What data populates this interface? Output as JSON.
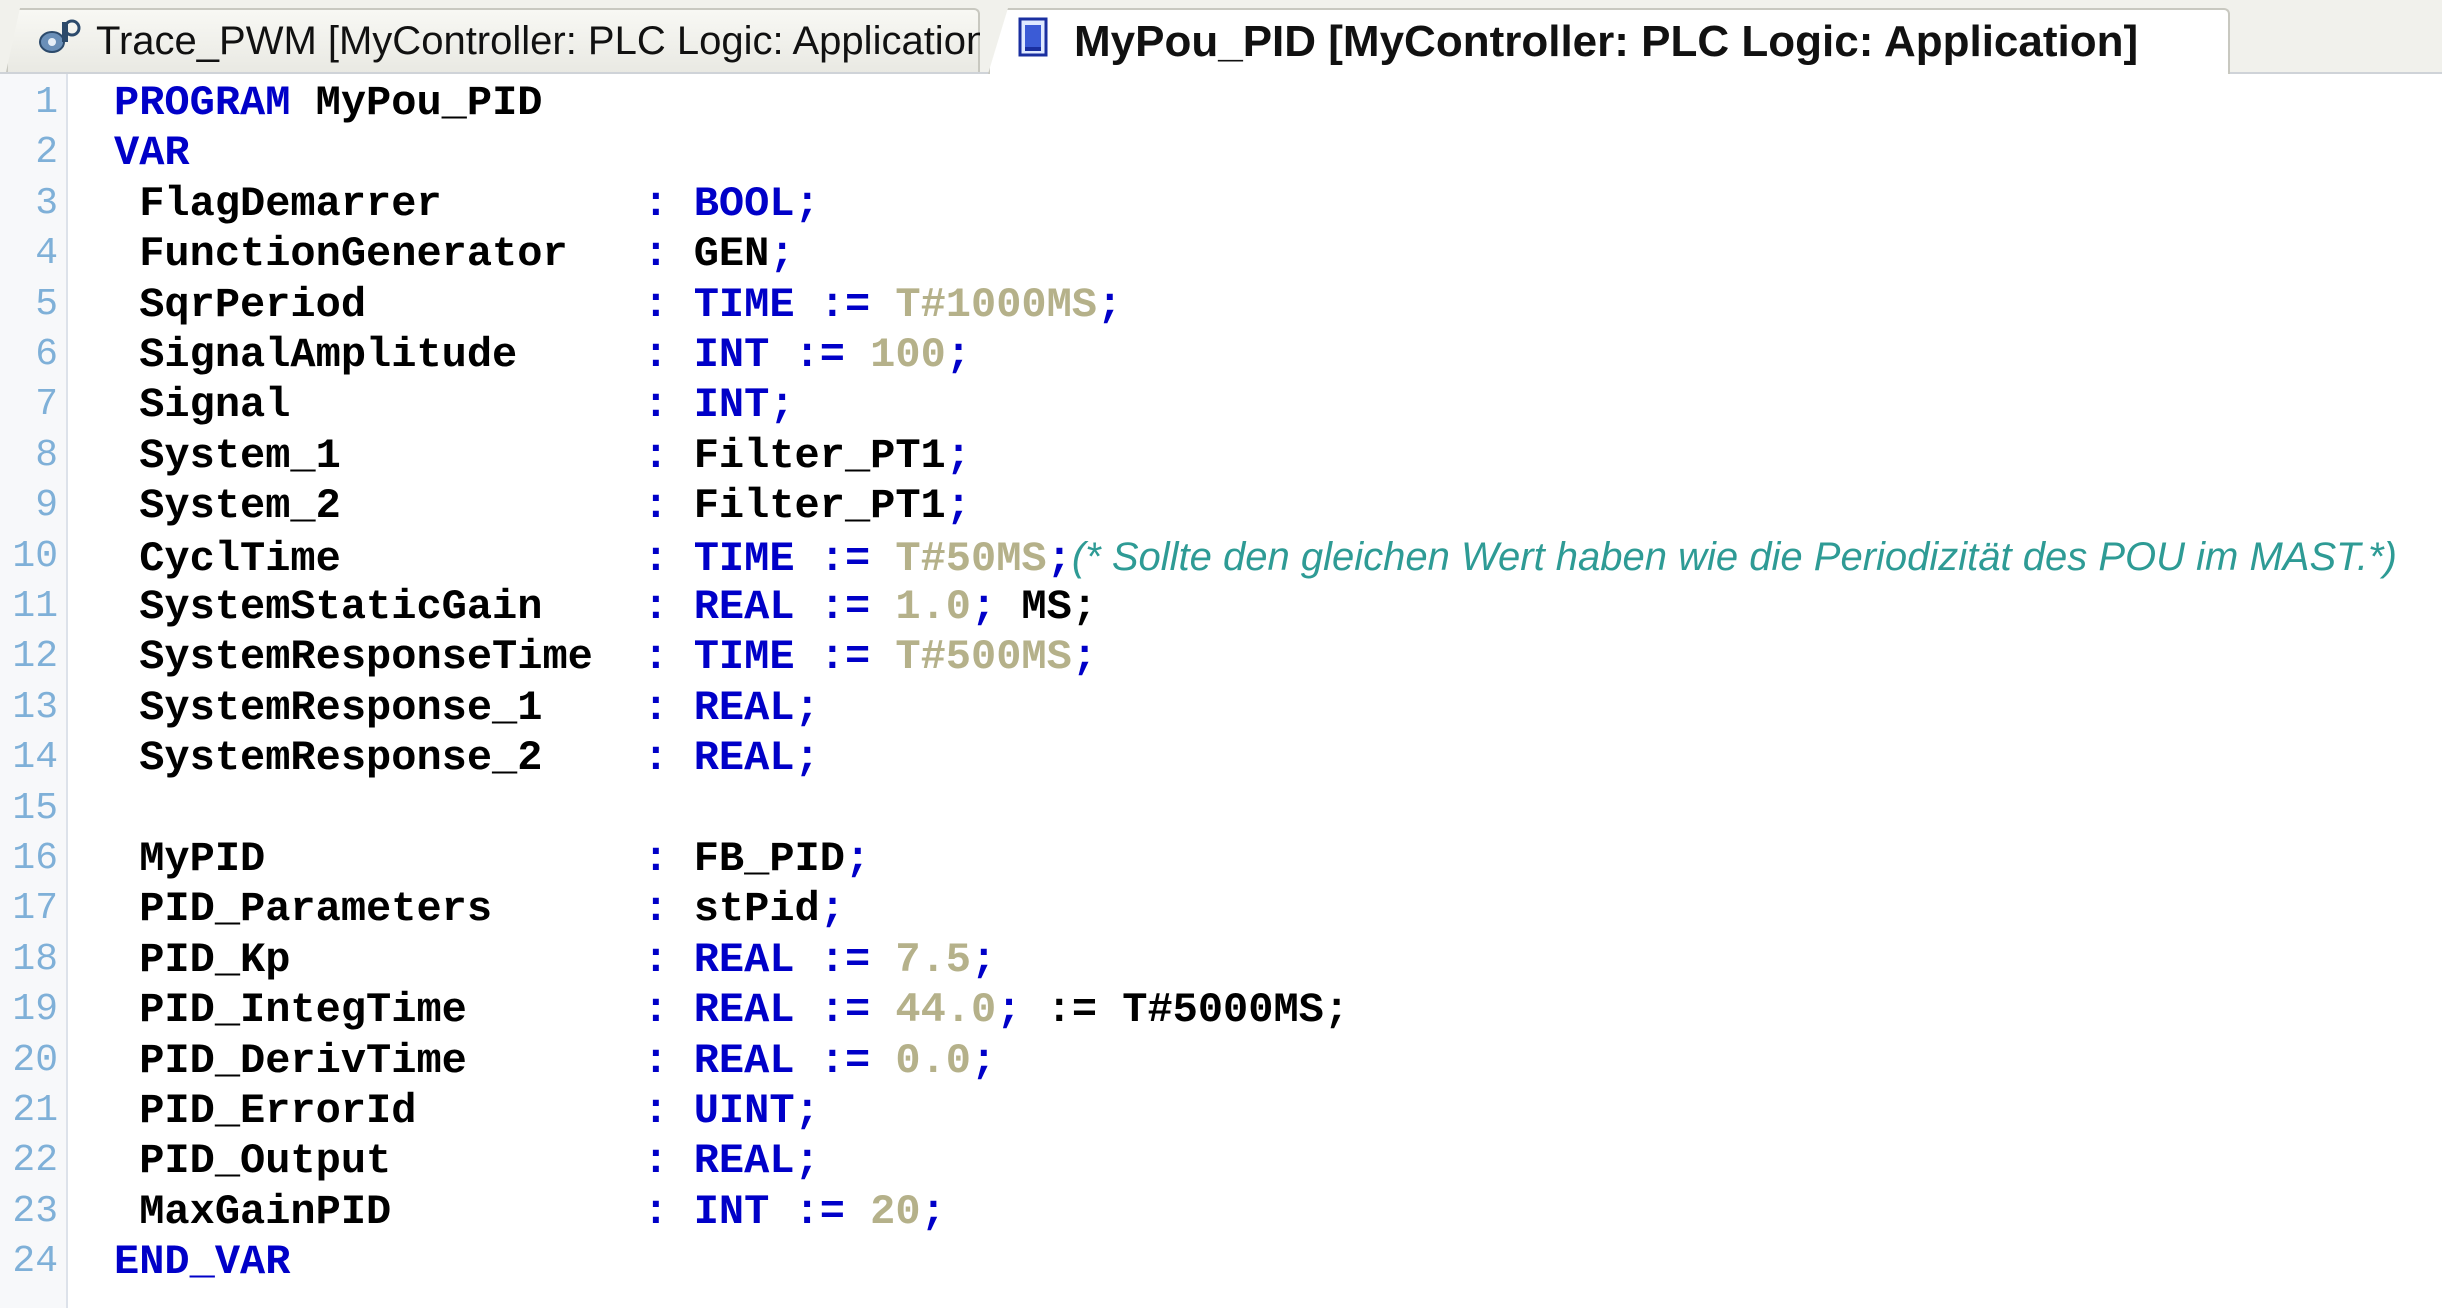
{
  "tabs": [
    {
      "label": "Trace_PWM [MyController: PLC Logic: Application]",
      "icon": "trace-icon",
      "active": false
    },
    {
      "label": "MyPou_PID [MyController: PLC Logic: Application]",
      "icon": "pou-icon",
      "active": true
    }
  ],
  "lines": [
    {
      "n": "1",
      "tokens": [
        [
          "kw",
          "PROGRAM"
        ],
        [
          "id",
          " MyPou_PID"
        ]
      ]
    },
    {
      "n": "2",
      "tokens": [
        [
          "kw",
          "VAR"
        ]
      ]
    },
    {
      "n": "3",
      "tokens": [
        [
          "id",
          " FlagDemarrer        "
        ],
        [
          "op",
          ": "
        ],
        [
          "kw",
          "BOOL"
        ],
        [
          "op",
          ";"
        ]
      ]
    },
    {
      "n": "4",
      "tokens": [
        [
          "id",
          " FunctionGenerator   "
        ],
        [
          "op",
          ": "
        ],
        [
          "id",
          "GEN"
        ],
        [
          "op",
          ";"
        ]
      ]
    },
    {
      "n": "5",
      "tokens": [
        [
          "id",
          " SqrPeriod           "
        ],
        [
          "op",
          ": "
        ],
        [
          "kw",
          "TIME"
        ],
        [
          "op",
          " := "
        ],
        [
          "lit",
          "T#1000MS"
        ],
        [
          "op",
          ";"
        ]
      ]
    },
    {
      "n": "6",
      "tokens": [
        [
          "id",
          " SignalAmplitude     "
        ],
        [
          "op",
          ": "
        ],
        [
          "kw",
          "INT"
        ],
        [
          "op",
          " := "
        ],
        [
          "lit",
          "100"
        ],
        [
          "op",
          ";"
        ]
      ]
    },
    {
      "n": "7",
      "tokens": [
        [
          "id",
          " Signal              "
        ],
        [
          "op",
          ": "
        ],
        [
          "kw",
          "INT"
        ],
        [
          "op",
          ";"
        ]
      ]
    },
    {
      "n": "8",
      "tokens": [
        [
          "id",
          " System_1            "
        ],
        [
          "op",
          ": "
        ],
        [
          "id",
          "Filter_PT1"
        ],
        [
          "op",
          ";"
        ]
      ]
    },
    {
      "n": "9",
      "tokens": [
        [
          "id",
          " System_2            "
        ],
        [
          "op",
          ": "
        ],
        [
          "id",
          "Filter_PT1"
        ],
        [
          "op",
          ";"
        ]
      ]
    },
    {
      "n": "10",
      "tokens": [
        [
          "id",
          " CyclTime            "
        ],
        [
          "op",
          ": "
        ],
        [
          "kw",
          "TIME"
        ],
        [
          "op",
          " := "
        ],
        [
          "lit",
          "T#50MS"
        ],
        [
          "op",
          ";"
        ],
        [
          "cmt",
          "(* Sollte den gleichen Wert haben wie die Periodizität des POU im MAST.*)"
        ]
      ]
    },
    {
      "n": "11",
      "tokens": [
        [
          "id",
          " SystemStaticGain    "
        ],
        [
          "op",
          ": "
        ],
        [
          "kw",
          "REAL"
        ],
        [
          "op",
          " := "
        ],
        [
          "lit",
          "1.0"
        ],
        [
          "op",
          "; "
        ],
        [
          "id",
          "MS;"
        ]
      ]
    },
    {
      "n": "12",
      "tokens": [
        [
          "id",
          " SystemResponseTime  "
        ],
        [
          "op",
          ": "
        ],
        [
          "kw",
          "TIME"
        ],
        [
          "op",
          " := "
        ],
        [
          "lit",
          "T#500MS"
        ],
        [
          "op",
          ";"
        ]
      ]
    },
    {
      "n": "13",
      "tokens": [
        [
          "id",
          " SystemResponse_1    "
        ],
        [
          "op",
          ": "
        ],
        [
          "kw",
          "REAL"
        ],
        [
          "op",
          ";"
        ]
      ]
    },
    {
      "n": "14",
      "tokens": [
        [
          "id",
          " SystemResponse_2    "
        ],
        [
          "op",
          ": "
        ],
        [
          "kw",
          "REAL"
        ],
        [
          "op",
          ";"
        ]
      ]
    },
    {
      "n": "15",
      "tokens": []
    },
    {
      "n": "16",
      "tokens": [
        [
          "id",
          " MyPID               "
        ],
        [
          "op",
          ": "
        ],
        [
          "id",
          "FB_PID"
        ],
        [
          "op",
          ";"
        ]
      ]
    },
    {
      "n": "17",
      "tokens": [
        [
          "id",
          " PID_Parameters      "
        ],
        [
          "op",
          ": "
        ],
        [
          "id",
          "stPid"
        ],
        [
          "op",
          ";"
        ]
      ]
    },
    {
      "n": "18",
      "tokens": [
        [
          "id",
          " PID_Kp              "
        ],
        [
          "op",
          ": "
        ],
        [
          "kw",
          "REAL"
        ],
        [
          "op",
          " := "
        ],
        [
          "lit",
          "7.5"
        ],
        [
          "op",
          ";"
        ]
      ]
    },
    {
      "n": "19",
      "tokens": [
        [
          "id",
          " PID_IntegTime       "
        ],
        [
          "op",
          ": "
        ],
        [
          "kw",
          "REAL"
        ],
        [
          "op",
          " := "
        ],
        [
          "lit",
          "44.0"
        ],
        [
          "op",
          ";"
        ],
        [
          "id",
          " := T#5000MS;"
        ]
      ]
    },
    {
      "n": "20",
      "tokens": [
        [
          "id",
          " PID_DerivTime       "
        ],
        [
          "op",
          ": "
        ],
        [
          "kw",
          "REAL"
        ],
        [
          "op",
          " := "
        ],
        [
          "lit",
          "0.0"
        ],
        [
          "op",
          ";"
        ]
      ]
    },
    {
      "n": "21",
      "tokens": [
        [
          "id",
          " PID_ErrorId         "
        ],
        [
          "op",
          ": "
        ],
        [
          "kw",
          "UINT"
        ],
        [
          "op",
          ";"
        ]
      ]
    },
    {
      "n": "22",
      "tokens": [
        [
          "id",
          " PID_Output          "
        ],
        [
          "op",
          ": "
        ],
        [
          "kw",
          "REAL"
        ],
        [
          "op",
          ";"
        ]
      ]
    },
    {
      "n": "23",
      "tokens": [
        [
          "id",
          " MaxGainPID          "
        ],
        [
          "op",
          ": "
        ],
        [
          "kw",
          "INT"
        ],
        [
          "op",
          " := "
        ],
        [
          "lit",
          "20"
        ],
        [
          "op",
          ";"
        ]
      ]
    },
    {
      "n": "24",
      "tokens": [
        [
          "kw",
          "END_VAR"
        ]
      ]
    }
  ]
}
